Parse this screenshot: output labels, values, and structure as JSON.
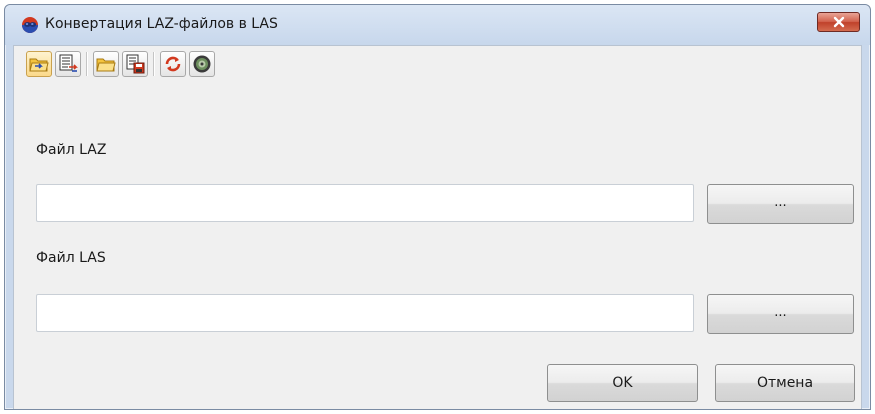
{
  "window": {
    "title": "Конвертация LAZ-файлов в LAS",
    "close_icon": "close-icon"
  },
  "toolbar": {
    "buttons": [
      {
        "icon": "open-folder-arrow-icon",
        "active": true
      },
      {
        "icon": "document-list-arrow-icon",
        "active": false
      },
      {
        "icon": "open-folder-icon",
        "active": false
      },
      {
        "icon": "save-document-icon",
        "active": false
      },
      {
        "icon": "refresh-icon",
        "active": false
      },
      {
        "icon": "settings-gear-icon",
        "active": false
      }
    ]
  },
  "form": {
    "laz_label": "Файл LAZ",
    "laz_value": "",
    "las_label": "Файл LAS",
    "las_value": "",
    "browse_label": "..."
  },
  "buttons": {
    "ok_label": "OK",
    "cancel_label": "Отмена"
  },
  "colors": {
    "titlebar": "#c7d7ec",
    "dialog_bg": "#f0f0f0",
    "close_button": "#c94a34",
    "active_tool": "#fbd98a"
  }
}
